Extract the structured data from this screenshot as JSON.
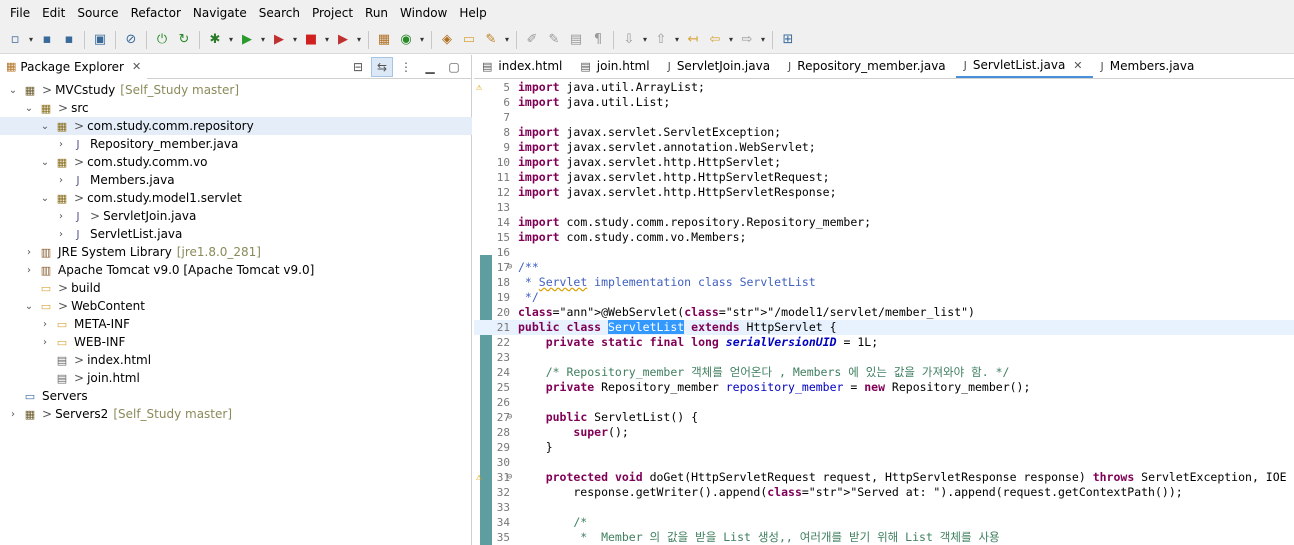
{
  "menu": [
    "File",
    "Edit",
    "Source",
    "Refactor",
    "Navigate",
    "Search",
    "Project",
    "Run",
    "Window",
    "Help"
  ],
  "explorer": {
    "title": "Package Explorer",
    "tree": [
      {
        "twisty": "v",
        "icon": "project",
        "arrow": ">",
        "label": "MVCstudy",
        "suffix": "[Self_Study master]"
      },
      {
        "twisty": "v",
        "icon": "src-folder",
        "arrow": ">",
        "label": "src",
        "suffix": ""
      },
      {
        "twisty": "v",
        "icon": "package",
        "arrow": ">",
        "label": "com.study.comm.repository",
        "suffix": ""
      },
      {
        "twisty": ">",
        "icon": "java-file",
        "arrow": "",
        "label": "Repository_member.java",
        "suffix": ""
      },
      {
        "twisty": "v",
        "icon": "package",
        "arrow": ">",
        "label": "com.study.comm.vo",
        "suffix": ""
      },
      {
        "twisty": ">",
        "icon": "java-file",
        "arrow": "",
        "label": "Members.java",
        "suffix": ""
      },
      {
        "twisty": "v",
        "icon": "package",
        "arrow": ">",
        "label": "com.study.model1.servlet",
        "suffix": ""
      },
      {
        "twisty": ">",
        "icon": "java-file",
        "arrow": ">",
        "label": "ServletJoin.java",
        "suffix": ""
      },
      {
        "twisty": ">",
        "icon": "java-file",
        "arrow": "",
        "label": "ServletList.java",
        "suffix": ""
      },
      {
        "twisty": ">",
        "icon": "library",
        "arrow": "",
        "label": "JRE System Library",
        "suffix": "[jre1.8.0_281]"
      },
      {
        "twisty": ">",
        "icon": "library",
        "arrow": "",
        "label": "Apache Tomcat v9.0 [Apache Tomcat v9.0]",
        "suffix": ""
      },
      {
        "twisty": "",
        "icon": "folder",
        "arrow": ">",
        "label": "build",
        "suffix": ""
      },
      {
        "twisty": "v",
        "icon": "folder",
        "arrow": ">",
        "label": "WebContent",
        "suffix": ""
      },
      {
        "twisty": ">",
        "icon": "folder",
        "arrow": "",
        "label": "META-INF",
        "suffix": ""
      },
      {
        "twisty": ">",
        "icon": "folder",
        "arrow": "",
        "label": "WEB-INF",
        "suffix": ""
      },
      {
        "twisty": "",
        "icon": "html-file",
        "arrow": ">",
        "label": "index.html",
        "suffix": ""
      },
      {
        "twisty": "",
        "icon": "html-file",
        "arrow": ">",
        "label": "join.html",
        "suffix": ""
      },
      {
        "twisty": "",
        "icon": "servers-folder",
        "arrow": "",
        "label": "Servers",
        "suffix": ""
      },
      {
        "twisty": ">",
        "icon": "project",
        "arrow": ">",
        "label": "Servers2",
        "suffix": "[Self_Study master]"
      }
    ]
  },
  "editor": {
    "tabs": [
      "index.html",
      "join.html",
      "ServletJoin.java",
      "Repository_member.java",
      "ServletList.java",
      "Members.java"
    ],
    "active_tab": "ServletList.java",
    "code": {
      "l5": [
        "5",
        "import java.util.ArrayList;"
      ],
      "l6": [
        "6",
        "import java.util.List;"
      ],
      "l7": [
        "7",
        ""
      ],
      "l8": [
        "8",
        "import javax.servlet.ServletException;"
      ],
      "l9": [
        "9",
        "import javax.servlet.annotation.WebServlet;"
      ],
      "l10": [
        "10",
        "import javax.servlet.http.HttpServlet;"
      ],
      "l11": [
        "11",
        "import javax.servlet.http.HttpServletRequest;"
      ],
      "l12": [
        "12",
        "import javax.servlet.http.HttpServletResponse;"
      ],
      "l13": [
        "13",
        ""
      ],
      "l14": [
        "14",
        "import com.study.comm.repository.Repository_member;"
      ],
      "l15": [
        "15",
        "import com.study.comm.vo.Members;"
      ],
      "l16": [
        "16",
        ""
      ],
      "l17": [
        "17",
        "/**"
      ],
      "l18": [
        "18",
        " * Servlet implementation class ServletList"
      ],
      "l19": [
        "19",
        " */"
      ],
      "l20": [
        "20",
        "@WebServlet(\"/model1/servlet/member_list\")"
      ],
      "l21": [
        "21",
        "public class ServletList extends HttpServlet {"
      ],
      "l22": [
        "22",
        "    private static final long serialVersionUID = 1L;"
      ],
      "l23": [
        "23",
        ""
      ],
      "l24": [
        "24",
        "    /* Repository_member 객체를 얻어온다 , Members 에 있는 값을 가져와야 함. */"
      ],
      "l25": [
        "25",
        "    private Repository_member repository_member = new Repository_member();"
      ],
      "l26": [
        "26",
        ""
      ],
      "l27": [
        "27",
        "    public ServletList() {"
      ],
      "l28": [
        "28",
        "        super();"
      ],
      "l29": [
        "29",
        "    }"
      ],
      "l30": [
        "30",
        ""
      ],
      "l31": [
        "31",
        "    protected void doGet(HttpServletRequest request, HttpServletResponse response) throws ServletException, IOE"
      ],
      "l32": [
        "32",
        "        response.getWriter().append(\"Served at: \").append(request.getContextPath());"
      ],
      "l33": [
        "33",
        ""
      ],
      "l34": [
        "34",
        "        /*"
      ],
      "l35": [
        "35",
        "         *  Member 의 값을 받을 List 생성,, 여러개를 받기 위해 List 객체를 사용"
      ]
    }
  }
}
